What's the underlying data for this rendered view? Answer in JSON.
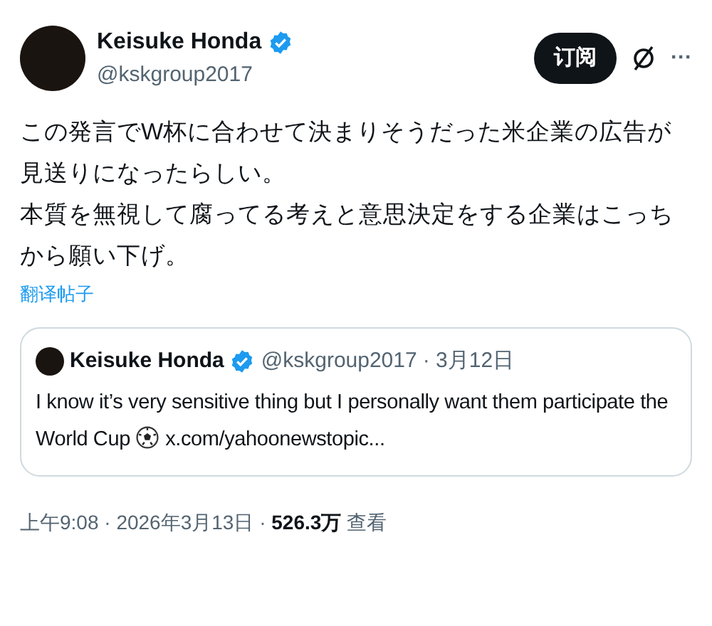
{
  "author": {
    "name": "Keisuke Honda",
    "verified": true,
    "handle": "@kskgroup2017"
  },
  "actions": {
    "subscribe": "订阅",
    "more": "···"
  },
  "post": {
    "paragraphs": [
      "この発言でW杯に合わせて決まりそうだった米企業の広告が見送りになったらしい。",
      "本質を無視して腐ってる考えと意思決定をする企業はこっちから願い下げ。"
    ],
    "translate": "翻译帖子"
  },
  "quote": {
    "name": "Keisuke Honda",
    "verified": true,
    "handle": "@kskgroup2017",
    "date": "· 3月12日",
    "text": "I know it’s very sensitive thing but I personally want them participate the World Cup",
    "link": "x.com/yahoonewstopic..."
  },
  "meta": {
    "time": "上午9:08 · 2026年3月13日 · ",
    "views": "526.3万",
    "views_label": "查看"
  }
}
